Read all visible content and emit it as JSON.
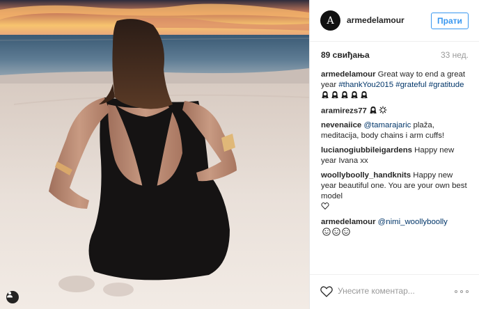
{
  "header": {
    "avatar_letter": "A",
    "username": "armedelamour",
    "follow_label": "Прати"
  },
  "meta": {
    "likes": "89 свиђања",
    "age": "33 нед."
  },
  "comments": [
    {
      "user": "armedelamour",
      "segments": [
        {
          "text": " Great way to end a great year ",
          "link": false
        },
        {
          "text": "#thankYou2015",
          "link": true
        },
        {
          "text": " ",
          "link": false
        },
        {
          "text": "#grateful",
          "link": true
        },
        {
          "text": " ",
          "link": false
        },
        {
          "text": "#gratitude",
          "link": true
        }
      ],
      "emoji_icons": [
        "woman-emoji",
        "woman-emoji",
        "woman-emoji",
        "woman-emoji",
        "woman-emoji"
      ]
    },
    {
      "user": "aramirezs77",
      "segments": [],
      "emoji_icons": [
        "woman-emoji",
        "sun-emoji"
      ]
    },
    {
      "user": "nevenaiice",
      "segments": [
        {
          "text": " ",
          "link": false
        },
        {
          "text": "@tamarajaric",
          "link": true
        },
        {
          "text": " plaža, meditacija, body chains i arm cuffs!",
          "link": false
        }
      ],
      "emoji_icons": []
    },
    {
      "user": "lucianogiubbileigardens",
      "segments": [
        {
          "text": " Happy new year Ivana xx",
          "link": false
        }
      ],
      "emoji_icons": []
    },
    {
      "user": "woollyboolly_handknits",
      "segments": [
        {
          "text": " Happy new year beautiful one. You are your own best model",
          "link": false
        }
      ],
      "emoji_icons": [
        "heart-outline-emoji"
      ]
    },
    {
      "user": "armedelamour",
      "segments": [
        {
          "text": " ",
          "link": false
        },
        {
          "text": "@nimi_woollyboolly",
          "link": true
        }
      ],
      "emoji_icons": [
        "tongue-face-emoji",
        "tongue-face-emoji",
        "tongue-face-emoji"
      ]
    }
  ],
  "footer": {
    "comment_placeholder": "Унесите коментар..."
  },
  "colors": {
    "follow_blue": "#3897f0",
    "link_blue": "#003569",
    "text": "#262626",
    "muted": "#999999"
  }
}
